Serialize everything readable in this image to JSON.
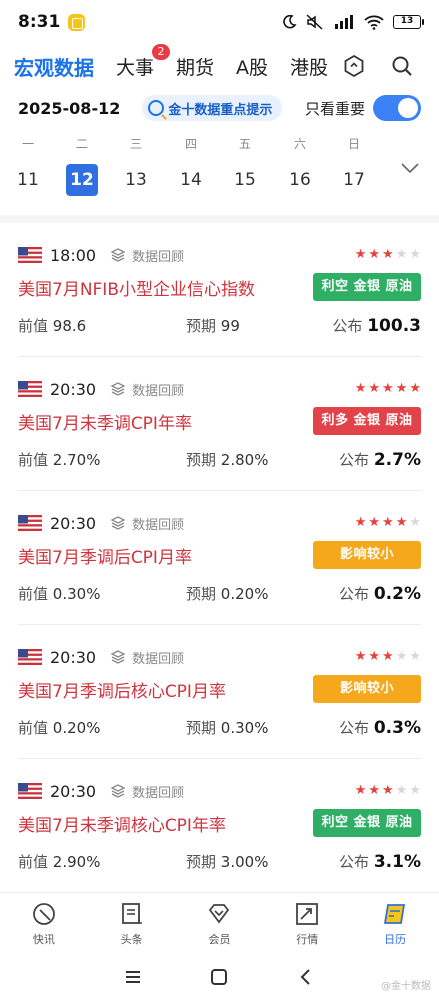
{
  "status": {
    "time": "8:31",
    "battery": "13"
  },
  "nav": {
    "tabs": [
      {
        "label": "宏观数据",
        "active": true
      },
      {
        "label": "大事",
        "badge": "2"
      },
      {
        "label": "期货"
      },
      {
        "label": "A股"
      },
      {
        "label": "港股"
      }
    ]
  },
  "date_row": {
    "date": "2025-08-12",
    "tip": "金十数据重点提示",
    "toggle_label": "只看重要",
    "toggle_on": true
  },
  "week": [
    {
      "weekday": "一",
      "day": "11"
    },
    {
      "weekday": "二",
      "day": "12",
      "active": true
    },
    {
      "weekday": "三",
      "day": "13"
    },
    {
      "weekday": "四",
      "day": "14"
    },
    {
      "weekday": "五",
      "day": "15"
    },
    {
      "weekday": "六",
      "day": "16"
    },
    {
      "weekday": "日",
      "day": "17"
    }
  ],
  "events": [
    {
      "time": "18:00",
      "tag": "数据回顾",
      "stars": 3,
      "title": "美国7月NFIB小型企业信心指数",
      "impact": "利空 金银 原油",
      "impact_color": "#2fae66",
      "prev_label": "前值",
      "prev": "98.6",
      "fcst_label": "预期",
      "fcst": "99",
      "act_label": "公布",
      "act": "100.3"
    },
    {
      "time": "20:30",
      "tag": "数据回顾",
      "stars": 5,
      "title": "美国7月未季调CPI年率",
      "impact": "利多 金银 原油",
      "impact_color": "#e2434b",
      "prev_label": "前值",
      "prev": "2.70%",
      "fcst_label": "预期",
      "fcst": "2.80%",
      "act_label": "公布",
      "act": "2.7%"
    },
    {
      "time": "20:30",
      "tag": "数据回顾",
      "stars": 4,
      "title": "美国7月季调后CPI月率",
      "impact": "影响较小",
      "impact_color": "#f5a81c",
      "prev_label": "前值",
      "prev": "0.30%",
      "fcst_label": "预期",
      "fcst": "0.20%",
      "act_label": "公布",
      "act": "0.2%"
    },
    {
      "time": "20:30",
      "tag": "数据回顾",
      "stars": 3,
      "title": "美国7月季调后核心CPI月率",
      "impact": "影响较小",
      "impact_color": "#f5a81c",
      "prev_label": "前值",
      "prev": "0.20%",
      "fcst_label": "预期",
      "fcst": "0.30%",
      "act_label": "公布",
      "act": "0.3%"
    },
    {
      "time": "20:30",
      "tag": "数据回顾",
      "stars": 3,
      "title": "美国7月未季调核心CPI年率",
      "impact": "利空 金银 原油",
      "impact_color": "#2fae66",
      "prev_label": "前值",
      "prev": "2.90%",
      "fcst_label": "预期",
      "fcst": "3.00%",
      "act_label": "公布",
      "act": "3.1%"
    }
  ],
  "tabbar": [
    {
      "label": "快讯",
      "icon": "flash-news-icon"
    },
    {
      "label": "头条",
      "icon": "headline-icon"
    },
    {
      "label": "会员",
      "icon": "vip-diamond-icon"
    },
    {
      "label": "行情",
      "icon": "market-chart-icon"
    },
    {
      "label": "日历",
      "icon": "calendar-icon",
      "active": true
    }
  ],
  "watermark": "@金十数据"
}
